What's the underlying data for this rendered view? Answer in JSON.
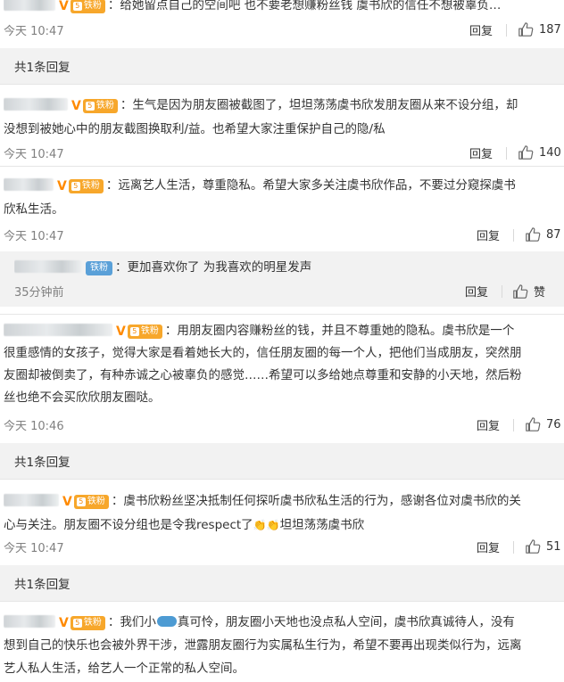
{
  "comments": [
    {
      "text": "：给她留点自己的空间吧 也不要老想赚粉丝钱 虞书欣的信任不想被辜负…",
      "time": "今天 10:47",
      "reply": "回复",
      "likes": "187",
      "more_replies": "共1条回复"
    },
    {
      "text1": "：生气是因为朋友圈被截图了，坦坦荡荡虞书欣发朋友圈从来不设分组，却",
      "text2": "没想到被她心中的朋友截图换取利/益。也希望大家注重保护自己的隐/私",
      "time": "今天 10:47",
      "reply": "回复",
      "likes": "140"
    },
    {
      "text1": "：远离艺人生活，尊重隐私。希望大家多关注虞书欣作品，不要过分窥探虞书",
      "text2": "欣私生活。",
      "time": "今天 10:47",
      "reply": "回复",
      "likes": "87",
      "sub": {
        "badge": "铁粉",
        "text": "：更加喜欢你了  为我喜欢的明星发声",
        "time": "35分钟前",
        "reply": "回复",
        "likes": "赞"
      }
    },
    {
      "text1": "：用朋友圈内容赚粉丝的钱，并且不尊重她的隐私。虞书欣是一个",
      "text2": "很重感情的女孩子，觉得大家是看着她长大的，信任朋友圈的每一个人，把他们当成朋友，突然朋",
      "text3": "友圈却被倒卖了，有种赤诚之心被辜负的感觉……希望可以多给她点尊重和安静的小天地，然后粉",
      "text4": "丝也绝不会买欣欣朋友圈哒。",
      "time": "今天 10:46",
      "reply": "回复",
      "likes": "76",
      "more_replies": "共1条回复"
    },
    {
      "text1": "：虞书欣粉丝坚决抵制任何探听虞书欣私生活的行为，感谢各位对虞书欣的关",
      "text2a": "心与关注。朋友圈不设分组也是令我respect了",
      "text2b": "坦坦荡荡虞书欣",
      "time": "今天 10:47",
      "reply": "回复",
      "likes": "51",
      "more_replies": "共1条回复"
    },
    {
      "text1a": "：我们小",
      "text1b": "真可怜，朋友圈小天地也没点私人空间，虞书欣真诚待人，没有",
      "text2": "想到自己的快乐也会被外界干涉，泄露朋友圈行为实属私生行为，希望不要再出现类似行为，远离",
      "text3": "艺人私人生活，给艺人一个正常的私人空间。"
    }
  ],
  "badge": {
    "v": "V",
    "fan_label": "铁粉",
    "fan_level": "5"
  }
}
